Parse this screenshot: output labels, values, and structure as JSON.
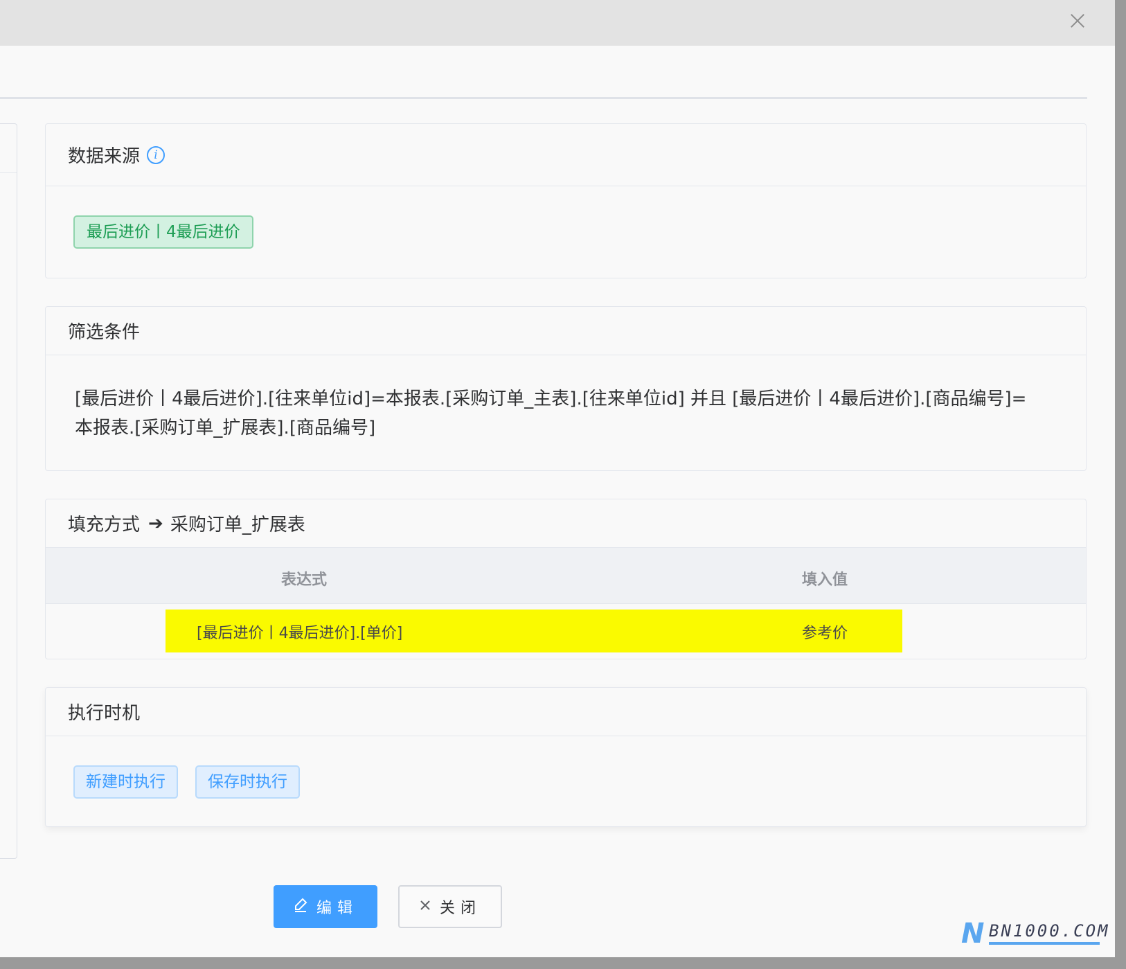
{
  "dialog": {
    "close_icon": "close-icon"
  },
  "data_source": {
    "title": "数据来源",
    "info_icon": "info-icon",
    "tag": "最后进价丨4最后进价"
  },
  "filter": {
    "title": "筛选条件",
    "condition": "[最后进价丨4最后进价].[往来单位id]=本报表.[采购订单_主表].[往来单位id] 并且 [最后进价丨4最后进价].[商品编号]=本报表.[采购订单_扩展表].[商品编号]"
  },
  "fill": {
    "title_prefix": "填充方式",
    "arrow": "➔",
    "title_target": "采购订单_扩展表",
    "columns": [
      "表达式",
      "填入值"
    ],
    "rows": [
      {
        "expression": "[最后进价丨4最后进价].[单价]",
        "value": "参考价"
      }
    ],
    "highlight_color": "#fafa00"
  },
  "timing": {
    "title": "执行时机",
    "tags": [
      "新建时执行",
      "保存时执行"
    ]
  },
  "footer": {
    "edit_label": "编辑",
    "close_label": "关闭"
  },
  "watermark": {
    "letter": "N",
    "text": "BN1000.COM"
  },
  "colors": {
    "primary": "#409eff",
    "success_tag_text": "#1e9e55",
    "success_tag_bg": "#d3f1e1"
  }
}
